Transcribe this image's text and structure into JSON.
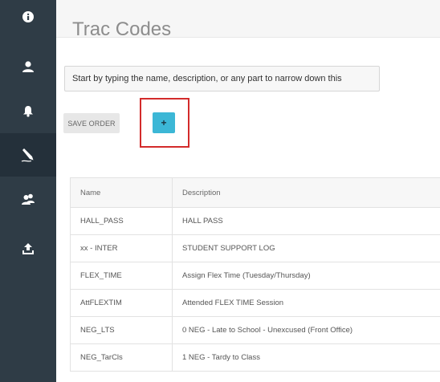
{
  "sidebar": {
    "items": [
      {
        "icon": "info-icon"
      },
      {
        "icon": "user-icon"
      },
      {
        "icon": "bell-icon"
      },
      {
        "icon": "pencil-icon",
        "active": true
      },
      {
        "icon": "users-icon"
      },
      {
        "icon": "upload-icon"
      }
    ]
  },
  "page": {
    "title": "Trac Codes"
  },
  "search": {
    "placeholder": "Start by typing the name, description, or any part to narrow down this"
  },
  "toolbar": {
    "save_order_label": "SAVE ORDER",
    "add_label": "+"
  },
  "table": {
    "headers": {
      "name": "Name",
      "description": "Description"
    },
    "rows": [
      {
        "name": "HALL_PASS",
        "description": "HALL PASS"
      },
      {
        "name": "xx - INTER",
        "description": "STUDENT SUPPORT LOG"
      },
      {
        "name": "FLEX_TIME",
        "description": "Assign Flex Time (Tuesday/Thursday)"
      },
      {
        "name": "AttFLEXTIM",
        "description": "Attended FLEX TIME Session"
      },
      {
        "name": "NEG_LTS",
        "description": "0 NEG - Late to School - Unexcused (Front Office)"
      },
      {
        "name": "NEG_TarCls",
        "description": "1 NEG - Tardy to Class"
      }
    ]
  },
  "colors": {
    "sidebar_bg": "#2f3c46",
    "sidebar_active": "#24303a",
    "accent": "#3cb7d6",
    "highlight": "#d32b2b"
  }
}
